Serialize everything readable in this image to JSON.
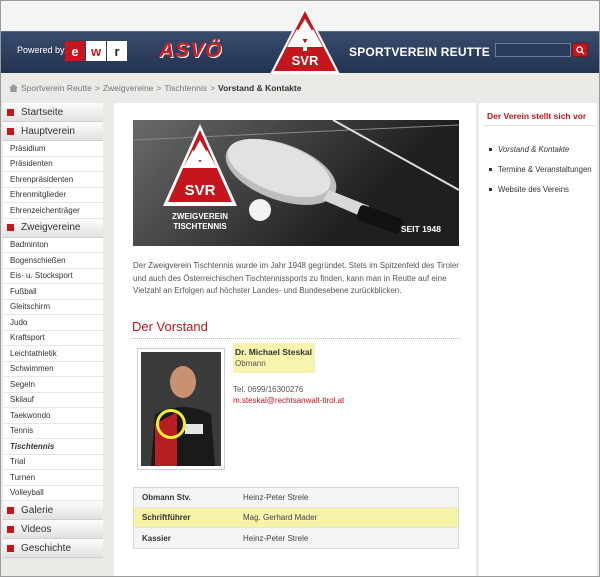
{
  "header": {
    "powered_by": "Powered by",
    "sponsor_logo": "ewr",
    "asvo_logo": "ASVÖ",
    "emblem_text": "SVR",
    "site_title": "SPORTVEREIN REUTTE",
    "search": {
      "value": "",
      "placeholder": ""
    },
    "colors": {
      "accent": "#c4161c",
      "header_bg": "#233452"
    }
  },
  "breadcrumb": {
    "items": [
      "Sportverein Reutte",
      "Zweigvereine",
      "Tischtennis"
    ],
    "current": "Vorstand & Kontakte",
    "separator": ">"
  },
  "sidebar": {
    "groups": [
      {
        "label": "Startseite",
        "items": []
      },
      {
        "label": "Hauptverein",
        "items": [
          "Präsidium",
          "Präsidenten",
          "Ehrenpräsidenten",
          "Ehrenmitglieder",
          "Ehrenzeichenträger"
        ]
      },
      {
        "label": "Zweigvereine",
        "items": [
          "Badminton",
          "Bogenschießen",
          "Eis- u. Stocksport",
          "Fußball",
          "Gleitschirm",
          "Judo",
          "Kraftsport",
          "Leichtathletik",
          "Schwimmen",
          "Segeln",
          "Skilauf",
          "Taekwondo",
          "Tennis",
          "Tischtennis",
          "Trial",
          "Turnen",
          "Volleyball"
        ]
      },
      {
        "label": "Galerie",
        "items": []
      },
      {
        "label": "Videos",
        "items": []
      },
      {
        "label": "Geschichte",
        "items": []
      }
    ],
    "active_item": "Tischtennis"
  },
  "banner": {
    "emblem_text": "SVR",
    "subtitle_line1": "ZWEIGVEREIN",
    "subtitle_line2": "TISCHTENNIS",
    "since": "SEIT 1948"
  },
  "main": {
    "intro": "Der Zweigverein Tischtennis wurde im Jahr 1948 gegründet. Stets im Spitzenfeld des Tiroler und auch des Österreichischen Tischtennissports zu finden, kann man in Reutte auf eine Vielzahl an Erfolgen auf höchster Landes- und Bundesebene zurückblicken.",
    "section_title": "Der Vorstand",
    "contact": {
      "name": "Dr. Michael Steskal",
      "role": "Obmann",
      "phone": "Tel. 0699/16300276",
      "email": "m.steskal@rechtsanwalt-tirol.at"
    },
    "board": [
      {
        "role": "Obmann Stv.",
        "name": "Heinz-Peter Strele",
        "highlight": false
      },
      {
        "role": "Schriftführer",
        "name": "Mag. Gerhard Mader",
        "highlight": true
      },
      {
        "role": "Kassier",
        "name": "Heinz-Peter Strele",
        "highlight": false
      }
    ]
  },
  "right": {
    "heading": "Der Verein stellt sich vor",
    "links": [
      "Vorstand & Kontakte",
      "Termine & Veranstaltungen",
      "Website des Vereins"
    ]
  }
}
